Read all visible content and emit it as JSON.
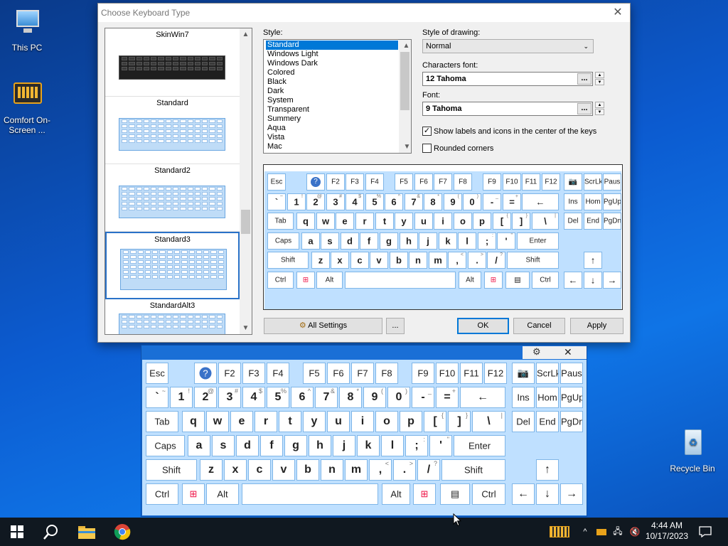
{
  "desktop": {
    "icons": [
      {
        "label": "This PC"
      },
      {
        "label": "Comfort On-Screen ..."
      },
      {
        "label": "Recycle Bin"
      }
    ]
  },
  "dialog": {
    "title": "Choose Keyboard Type",
    "layouts": [
      "SkinWin7",
      "Standard",
      "Standard2",
      "Standard3",
      "StandardAlt3"
    ],
    "selected_layout": "Standard3",
    "style_label": "Style:",
    "styles": [
      "Standard",
      "Windows Light",
      "Windows Dark",
      "Colored",
      "Black",
      "Dark",
      "System",
      "Transparent",
      "Summery",
      "Aqua",
      "Vista",
      "Mac"
    ],
    "selected_style": "Standard",
    "drawing_label": "Style of drawing:",
    "drawing_value": "Normal",
    "chars_font_label": "Characters font:",
    "chars_font_value": "12 Tahoma",
    "font_label": "Font:",
    "font_value": "9 Tahoma",
    "show_labels": "Show labels and icons in the center of the keys",
    "show_labels_checked": true,
    "rounded": "Rounded corners",
    "rounded_checked": false,
    "buttons": {
      "all_settings": "All Settings",
      "more": "...",
      "ok": "OK",
      "cancel": "Cancel",
      "apply": "Apply"
    },
    "dots": "..."
  },
  "keyboard": {
    "rows": [
      [
        {
          "m": "Esc"
        },
        {
          "m": "?",
          "icon": "help-icon"
        },
        {
          "m": "F2"
        },
        {
          "m": "F3"
        },
        {
          "m": "F4"
        },
        {
          "m": "F5"
        },
        {
          "m": "F6"
        },
        {
          "m": "F7"
        },
        {
          "m": "F8"
        },
        {
          "m": "F9"
        },
        {
          "m": "F10"
        },
        {
          "m": "F11"
        },
        {
          "m": "F12"
        },
        {
          "m": "📷",
          "icon": "camera-icon"
        },
        {
          "m": "ScrLk"
        },
        {
          "m": "Paus"
        }
      ],
      [
        {
          "m": "`",
          "s": "~"
        },
        {
          "m": "1",
          "s": "!"
        },
        {
          "m": "2",
          "s": "@"
        },
        {
          "m": "3",
          "s": "#"
        },
        {
          "m": "4",
          "s": "$"
        },
        {
          "m": "5",
          "s": "%"
        },
        {
          "m": "6",
          "s": "^"
        },
        {
          "m": "7",
          "s": "&"
        },
        {
          "m": "8",
          "s": "*"
        },
        {
          "m": "9",
          "s": "("
        },
        {
          "m": "0",
          "s": ")"
        },
        {
          "m": "-",
          "s": "_"
        },
        {
          "m": "=",
          "s": "+"
        },
        {
          "m": "←"
        },
        {
          "m": "Ins"
        },
        {
          "m": "Hom"
        },
        {
          "m": "PgUp"
        }
      ],
      [
        {
          "m": "Tab"
        },
        {
          "m": "q"
        },
        {
          "m": "w"
        },
        {
          "m": "e"
        },
        {
          "m": "r"
        },
        {
          "m": "t"
        },
        {
          "m": "y"
        },
        {
          "m": "u"
        },
        {
          "m": "i"
        },
        {
          "m": "o"
        },
        {
          "m": "p"
        },
        {
          "m": "[",
          "s": "{"
        },
        {
          "m": "]",
          "s": "}"
        },
        {
          "m": "\\",
          "s": "|"
        },
        {
          "m": "Del"
        },
        {
          "m": "End"
        },
        {
          "m": "PgDn"
        }
      ],
      [
        {
          "m": "Caps"
        },
        {
          "m": "a"
        },
        {
          "m": "s"
        },
        {
          "m": "d"
        },
        {
          "m": "f"
        },
        {
          "m": "g"
        },
        {
          "m": "h"
        },
        {
          "m": "j"
        },
        {
          "m": "k"
        },
        {
          "m": "l"
        },
        {
          "m": ";",
          "s": ":"
        },
        {
          "m": "'",
          "s": "\""
        },
        {
          "m": "Enter"
        }
      ],
      [
        {
          "m": "Shift"
        },
        {
          "m": "z"
        },
        {
          "m": "x"
        },
        {
          "m": "c"
        },
        {
          "m": "v"
        },
        {
          "m": "b"
        },
        {
          "m": "n"
        },
        {
          "m": "m"
        },
        {
          "m": ",",
          "s": "<"
        },
        {
          "m": ".",
          "s": ">"
        },
        {
          "m": "/",
          "s": "?"
        },
        {
          "m": "Shift"
        },
        {
          "m": "↑"
        }
      ],
      [
        {
          "m": "Ctrl"
        },
        {
          "m": "⊞",
          "icon": "windows-icon"
        },
        {
          "m": "Alt"
        },
        {
          "m": ""
        },
        {
          "m": "Alt"
        },
        {
          "m": "⊞",
          "icon": "windows-icon"
        },
        {
          "m": "▤",
          "icon": "menu-icon"
        },
        {
          "m": "Ctrl"
        },
        {
          "m": "←"
        },
        {
          "m": "↓"
        },
        {
          "m": "→"
        }
      ]
    ],
    "toolbar": {
      "settings": "⚙",
      "close": "✕"
    }
  },
  "taskbar": {
    "time": "4:44 AM",
    "date": "10/17/2023"
  }
}
